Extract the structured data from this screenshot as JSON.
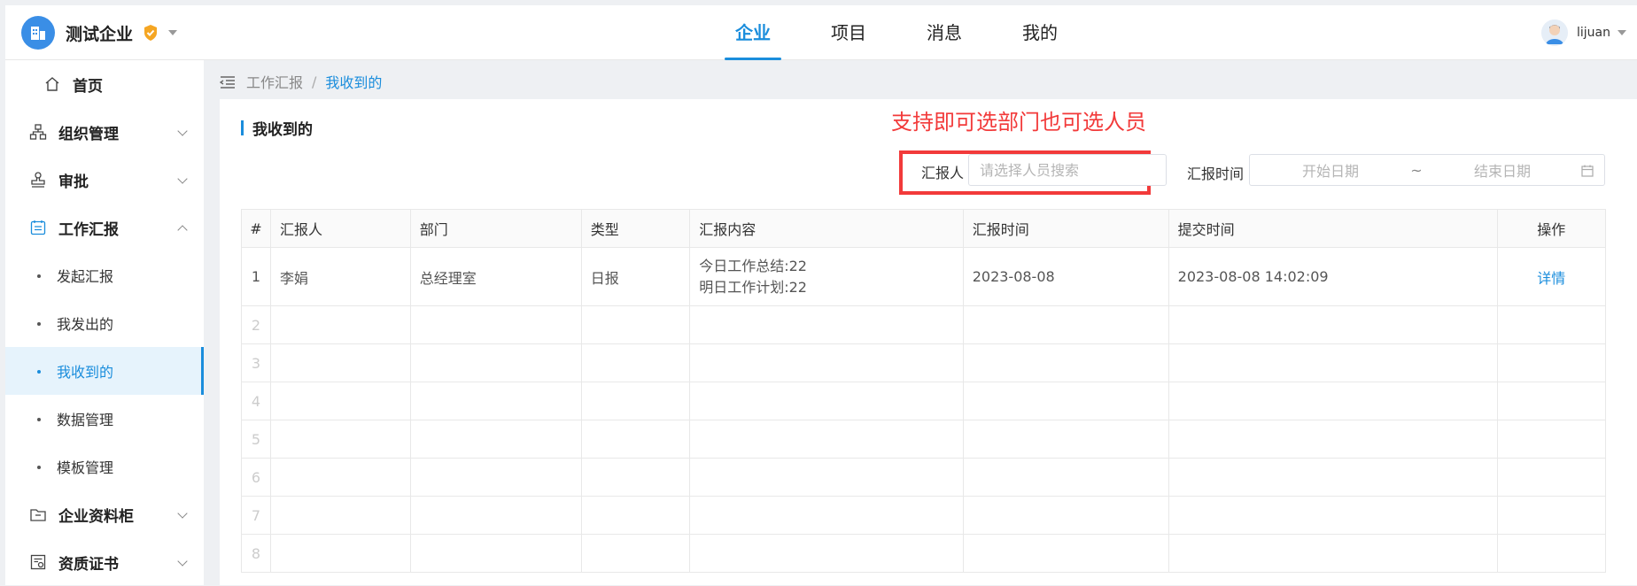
{
  "header": {
    "company_name": "测试企业",
    "nav": [
      {
        "label": "企业",
        "active": true
      },
      {
        "label": "项目",
        "active": false
      },
      {
        "label": "消息",
        "active": false
      },
      {
        "label": "我的",
        "active": false
      }
    ],
    "user_name": "lijuan"
  },
  "sidebar": {
    "home": "首页",
    "org": "组织管理",
    "approval": "审批",
    "work_report": "工作汇报",
    "sub": [
      "发起汇报",
      "我发出的",
      "我收到的",
      "数据管理",
      "模板管理"
    ],
    "active_sub": "我收到的",
    "cabinet": "企业资料柜",
    "certs": "资质证书"
  },
  "breadcrumb": {
    "parent": "工作汇报",
    "sep": "/",
    "current": "我收到的"
  },
  "panel": {
    "title": "我收到的",
    "annotation": "支持即可选部门也可选人员",
    "reporter_label": "汇报人",
    "reporter_placeholder": "请选择人员搜索",
    "time_label": "汇报时间",
    "date_start_placeholder": "开始日期",
    "date_sep": "~",
    "date_end_placeholder": "结束日期"
  },
  "table": {
    "headers": {
      "idx": "#",
      "reporter": "汇报人",
      "dept": "部门",
      "type": "类型",
      "content": "汇报内容",
      "report_time": "汇报时间",
      "submit_time": "提交时间",
      "op": "操作"
    },
    "row1": {
      "idx": "1",
      "reporter": "李娟",
      "dept": "总经理室",
      "type": "日报",
      "content_line1": "今日工作总结:22",
      "content_line2": "明日工作计划:22",
      "report_time": "2023-08-08",
      "submit_time": "2023-08-08 14:02:09",
      "op": "详情"
    },
    "empty_rows": [
      "2",
      "3",
      "4",
      "5",
      "6",
      "7",
      "8"
    ]
  },
  "colors": {
    "accent": "#1a8ddc",
    "annotation_red": "#f23a3a"
  }
}
